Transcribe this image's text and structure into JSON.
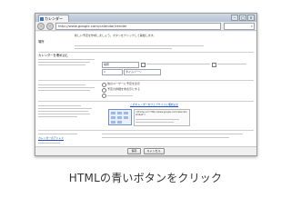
{
  "window": {
    "tab_title": "カレンダー",
    "url": "http://www.google.com/calendar/render",
    "controls": [
      "–",
      "□",
      "×"
    ]
  },
  "page": {
    "top_notice": "新しい予定を作成しましょう。ボタンをクリックして開始します。",
    "section1_label": "場所",
    "section2_label": "カレンダーを埋め込む",
    "select1_value": "場所",
    "select2_value": "1",
    "select3_value": "タイムゾーン",
    "option_text_1": "他のユーザーに予定を表示",
    "option_text_2": "予定の詳細を非表示にする",
    "embed_title": "このカレンダーをウェブサイトに埋め込む",
    "embed_code_line": "<iframe src=\"http://www.google.com/calendar/embed\">",
    "bottom_link": "カレンダーのアドレス",
    "save_button": "保存",
    "cancel_button": "キャンセル"
  },
  "caption": {
    "text": "HTMLの青いボタンをクリック"
  }
}
